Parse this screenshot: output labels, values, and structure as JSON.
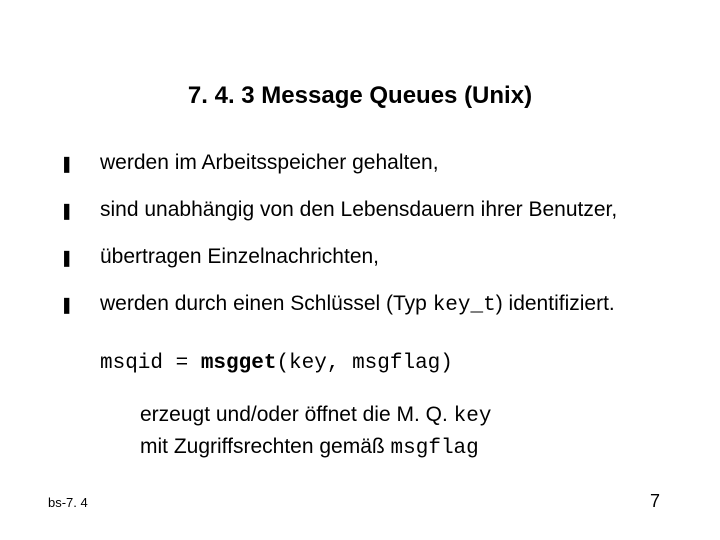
{
  "title": "7. 4. 3  Message Queues (Unix)",
  "bullets": [
    "werden im Arbeitsspeicher gehalten,",
    "sind unabhängig von den Lebensdauern ihrer Benutzer,",
    "übertragen Einzelnachrichten,"
  ],
  "bullet4": {
    "prefix": "werden durch einen Schlüssel (Typ ",
    "code": "key_t",
    "suffix": ") identifiziert."
  },
  "code": {
    "lhs": "msqid = ",
    "fn": "msgget",
    "args": "(key, msgflag)"
  },
  "desc": {
    "line1_a": "erzeugt und/oder öffnet die M. Q. ",
    "line1_b": "key",
    "line2_a": "mit Zugriffsrechten gemäß ",
    "line2_b": "msgflag"
  },
  "footer": {
    "left": "bs-7. 4",
    "right": "7"
  },
  "marker": "❚"
}
